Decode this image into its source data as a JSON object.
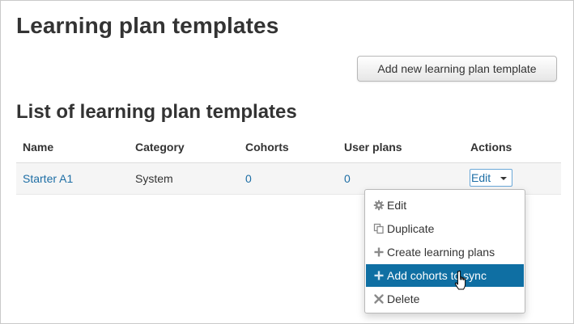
{
  "page": {
    "title": "Learning plan templates",
    "add_button_label": "Add new learning plan template",
    "section_title": "List of learning plan templates"
  },
  "table": {
    "columns": [
      "Name",
      "Category",
      "Cohorts",
      "User plans",
      "Actions"
    ],
    "rows": [
      {
        "name": "Starter A1",
        "category": "System",
        "cohorts": "0",
        "user_plans": "0",
        "action_label": "Edit"
      }
    ]
  },
  "actions_menu": {
    "items": [
      {
        "label": "Edit",
        "icon": "gear-icon"
      },
      {
        "label": "Duplicate",
        "icon": "copy-icon"
      },
      {
        "label": "Create learning plans",
        "icon": "plus-icon"
      },
      {
        "label": "Add cohorts to sync",
        "icon": "plus-icon",
        "active": true
      },
      {
        "label": "Delete",
        "icon": "x-icon"
      }
    ]
  },
  "colors": {
    "link": "#1d6ea5",
    "menu_highlight": "#0f6fa3",
    "row_background": "#f5f5f5"
  }
}
